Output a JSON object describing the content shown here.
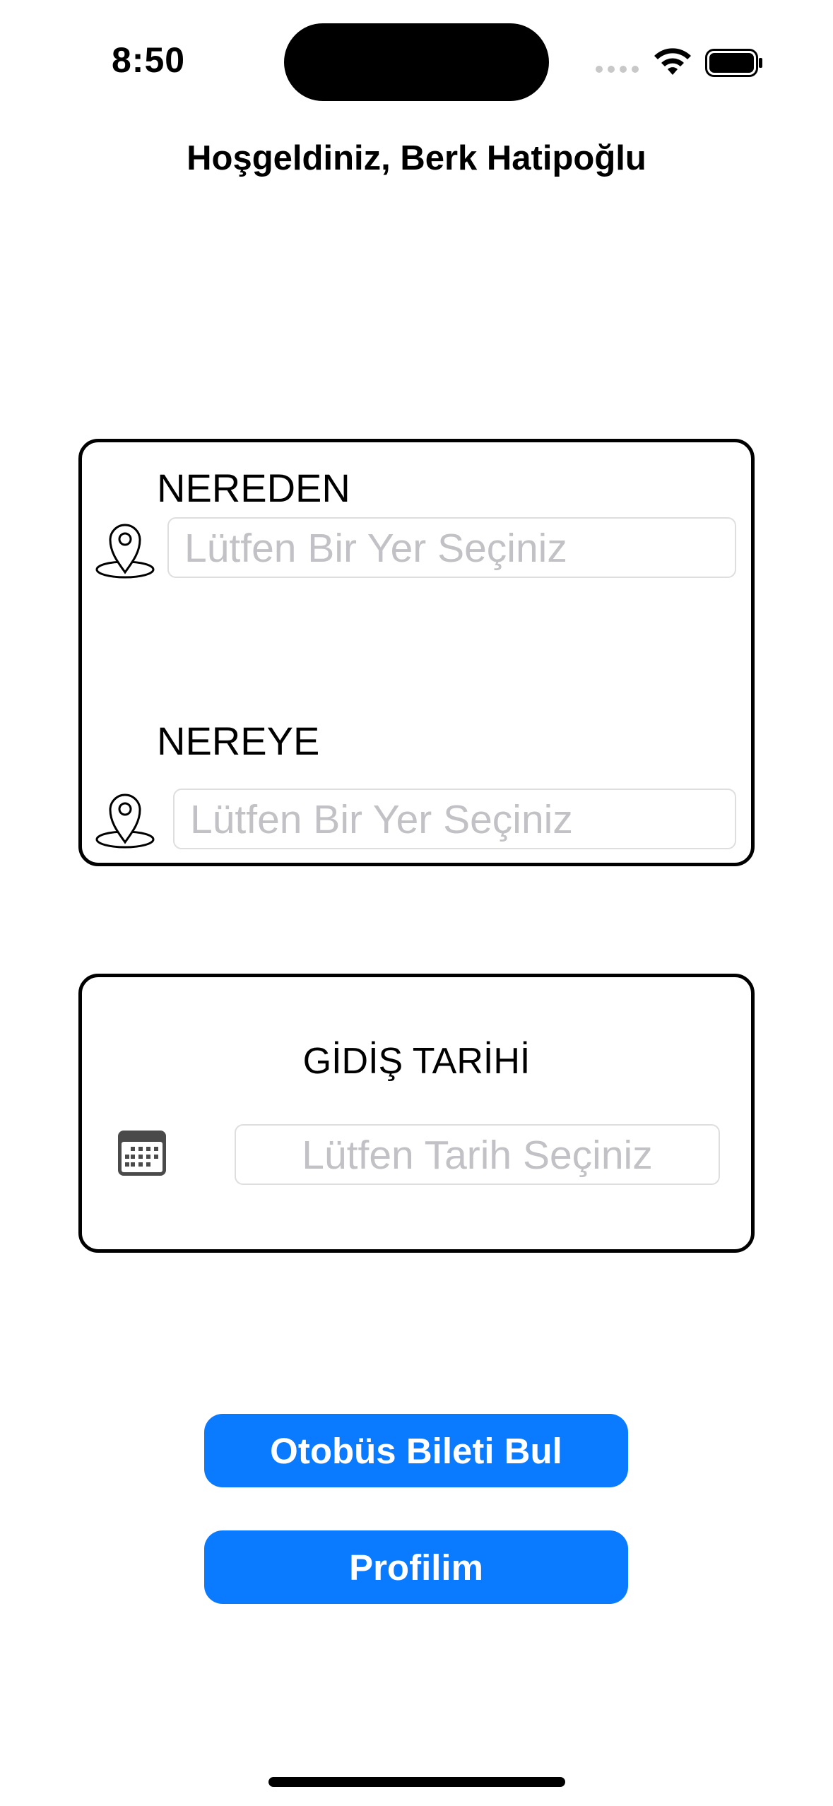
{
  "status_bar": {
    "time": "8:50",
    "icons": [
      "cellular-signal-icon",
      "wifi-icon",
      "battery-icon"
    ]
  },
  "header": {
    "welcome": "Hoşgeldiniz, Berk Hatipoğlu"
  },
  "route": {
    "from_label": "NEREDEN",
    "from_placeholder": "Lütfen Bir Yer Seçiniz",
    "to_label": "NEREYE",
    "to_placeholder": "Lütfen Bir Yer Seçiniz",
    "icon": "location-pin-icon"
  },
  "date": {
    "label": "GİDİŞ TARİHİ",
    "placeholder": "Lütfen Tarih Seçiniz",
    "icon": "calendar-icon"
  },
  "actions": {
    "search_label": "Otobüs Bileti Bul",
    "profile_label": "Profilim"
  },
  "colors": {
    "accent": "#0a7aff",
    "placeholder": "#c2c2c6",
    "border": "#000000"
  }
}
